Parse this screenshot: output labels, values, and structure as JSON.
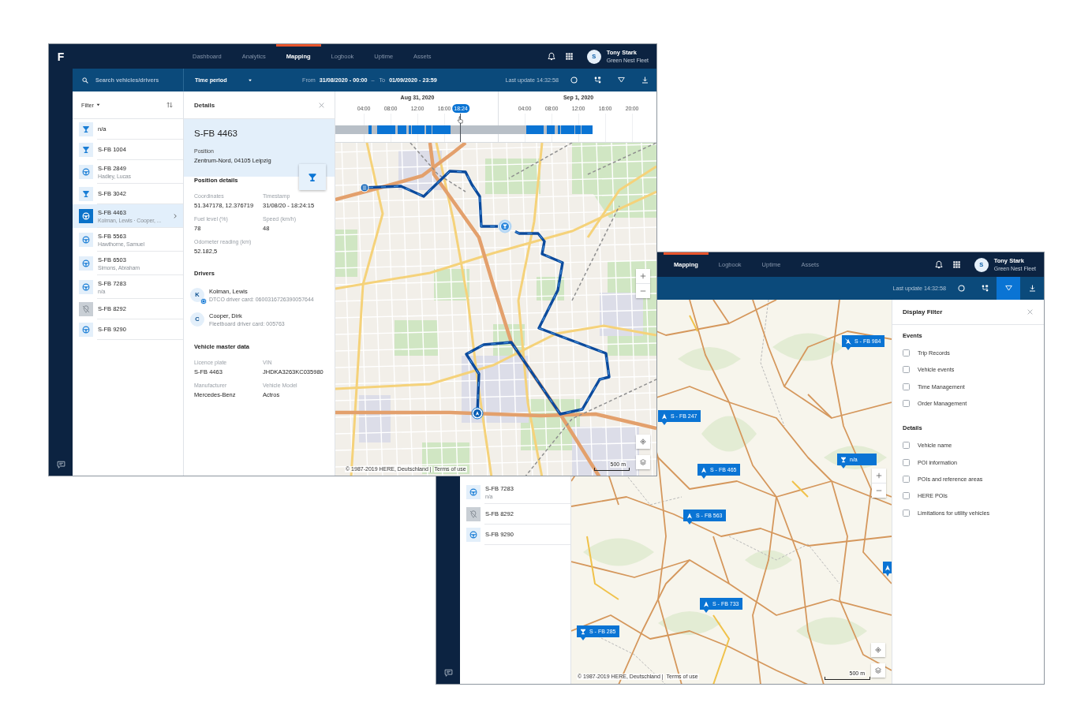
{
  "windows": [
    {
      "logo": "F",
      "app_bar": {
        "tabs": [
          {
            "label": "Dashboard",
            "selected": false
          },
          {
            "label": "Analytics",
            "selected": false
          },
          {
            "label": "Mapping",
            "selected": true
          },
          {
            "label": "Logbook",
            "selected": false
          },
          {
            "label": "Uptime",
            "selected": false
          },
          {
            "label": "Assets",
            "selected": false
          }
        ],
        "user": {
          "initial": "S",
          "name": "Tony Stark",
          "fleet": "Green Nest Fleet"
        }
      },
      "toolbar": {
        "search": {
          "placeholder": "Search vehicles/drivers"
        },
        "time_period": "Time period",
        "range": {
          "from_label": "From",
          "from": "31/08/2020 - 00:00",
          "separator": "–",
          "to_label": "To",
          "to": "01/09/2020 - 23:59"
        },
        "last_update": "Last update 14:32:58",
        "actions": [
          {
            "kind": "refresh",
            "selected": false
          },
          {
            "kind": "route",
            "selected": false
          },
          {
            "kind": "filter",
            "selected": false
          },
          {
            "kind": "download",
            "selected": false
          }
        ]
      },
      "vehicle_list": {
        "filter": "Filter",
        "rows": [
          {
            "kind": "tracker",
            "title": "n/a",
            "selected": false
          },
          {
            "kind": "tracker",
            "title": "S-FB 1004",
            "selected": false
          },
          {
            "kind": "vehicle",
            "title": "S-FB 2849",
            "subtitle": "Hadley, Lucas",
            "selected": false
          },
          {
            "kind": "tracker",
            "title": "S-FB 3042",
            "selected": false
          },
          {
            "kind": "vehicle",
            "title": "S-FB 4463",
            "subtitle": "Kolman, Lewis · Cooper, ...",
            "selected": true
          },
          {
            "kind": "vehicle",
            "title": "S-FB 5563",
            "subtitle": "Hawthorne, Samuel",
            "selected": false
          },
          {
            "kind": "vehicle",
            "title": "S-FB 6503",
            "subtitle": "Simons, Abraham",
            "selected": false
          },
          {
            "kind": "vehicle",
            "title": "S-FB 7283",
            "subtitle": "n/a",
            "selected": false
          },
          {
            "kind": "offline",
            "title": "S-FB 8292",
            "selected": false
          },
          {
            "kind": "vehicle",
            "title": "S-FB 9290",
            "selected": false
          }
        ]
      },
      "details": {
        "title": "Details",
        "vehicle": "S-FB 4463",
        "position_label": "Position",
        "position": "Zentrum-Nord, 04105 Leipzig",
        "sections": [
          {
            "kind": "fields",
            "heading": "Position details",
            "fields": [
              {
                "label": "Coordinates",
                "value": "51.347178, 12.376719"
              },
              {
                "label": "Timestamp",
                "value": "31/08/20 - 18:24:15"
              },
              {
                "label": "Fuel level (%)",
                "value": "78"
              },
              {
                "label": "Speed (km/h)",
                "value": "48"
              },
              {
                "label": "Odometer reading (km)",
                "value": "52.182,5"
              }
            ]
          },
          {
            "kind": "drivers",
            "heading": "Drivers",
            "drivers": [
              {
                "initial": "K",
                "name": "Kolman, Lewis",
                "card": "DTCO driver card: 0600316726390057644",
                "badge": true
              },
              {
                "initial": "C",
                "name": "Cooper, Dirk",
                "card": "Fleetboard driver card: 005763",
                "badge": false
              }
            ]
          },
          {
            "kind": "fields",
            "heading": "Vehicle master data",
            "fields": [
              {
                "label": "Licence plate",
                "value": "S-FB 4463"
              },
              {
                "label": "VIN",
                "value": "JHDKA3263KC035980"
              },
              {
                "label": "Manufacturer",
                "value": "Mercedes-Benz"
              },
              {
                "label": "Vehicle Model",
                "value": "Actros"
              }
            ]
          }
        ]
      },
      "timeline": {
        "days": [
          {
            "label": "Aug 31, 2020",
            "ticks": [
              "04:00",
              "08:00",
              "12:00",
              "16:00"
            ]
          },
          {
            "label": "Sep 1, 2020",
            "ticks": [
              "04:00",
              "08:00",
              "12:00",
              "16:00",
              "20:00"
            ]
          }
        ],
        "cursor": "18:24"
      },
      "map": {
        "kind": "street",
        "copyright": "© 1987-2019 HERE, Deutschland |",
        "terms": "Terms of use",
        "scale": "500 m"
      }
    },
    {
      "app_bar": {
        "tabs": [
          {
            "label": "Mapping",
            "selected": true
          },
          {
            "label": "Logbook",
            "selected": false
          },
          {
            "label": "Uptime",
            "selected": false
          },
          {
            "label": "Assets",
            "selected": false
          }
        ],
        "user": {
          "initial": "S",
          "name": "Tony Stark",
          "fleet": "Green Nest Fleet"
        }
      },
      "toolbar": {
        "last_update": "Last update 14:32:58",
        "actions": [
          {
            "kind": "refresh",
            "selected": false
          },
          {
            "kind": "route",
            "selected": false
          },
          {
            "kind": "filter",
            "selected": true
          },
          {
            "kind": "download",
            "selected": false
          }
        ]
      },
      "vehicle_list": {
        "rows": [
          {
            "kind": "vehicle",
            "title": "S-FB 7283",
            "subtitle": "n/a",
            "selected": false
          },
          {
            "kind": "offline",
            "title": "S-FB 8292",
            "selected": false
          },
          {
            "kind": "vehicle",
            "title": "S-FB 9290",
            "selected": false
          }
        ]
      },
      "map": {
        "kind": "road",
        "markers": [
          {
            "kind": "offline",
            "label": "S - FB 984"
          },
          {
            "kind": "navigation",
            "label": "S - FB 247"
          },
          {
            "kind": "navigation",
            "label": "S - FB 465"
          },
          {
            "kind": "tracker",
            "label": "n/a"
          },
          {
            "kind": "navigation",
            "label": "S - FB 563"
          },
          {
            "kind": "navigation",
            "label": "S - FB 733"
          },
          {
            "kind": "tracker",
            "label": "S - FB 285"
          },
          {
            "kind": "navigation"
          }
        ],
        "copyright": "© 1987-2019 HERE, Deutschland |",
        "terms": "Terms of use",
        "scale": "500 m"
      },
      "display_filter": {
        "title": "Display Filter",
        "groups": [
          {
            "heading": "Events",
            "options": [
              {
                "label": "Trip Records",
                "checked": false
              },
              {
                "label": "Vehicle events",
                "checked": false
              },
              {
                "label": "Time Management",
                "checked": false
              },
              {
                "label": "Order Management",
                "checked": false
              }
            ]
          },
          {
            "heading": "Details",
            "options": [
              {
                "label": "Vehicle name",
                "checked": false
              },
              {
                "label": "POI information",
                "checked": false
              },
              {
                "label": "POIs and reference areas",
                "checked": false
              },
              {
                "label": "HERE POIs",
                "checked": false
              },
              {
                "label": "Limitations for utility vehicles",
                "checked": false
              }
            ]
          }
        ]
      }
    }
  ]
}
